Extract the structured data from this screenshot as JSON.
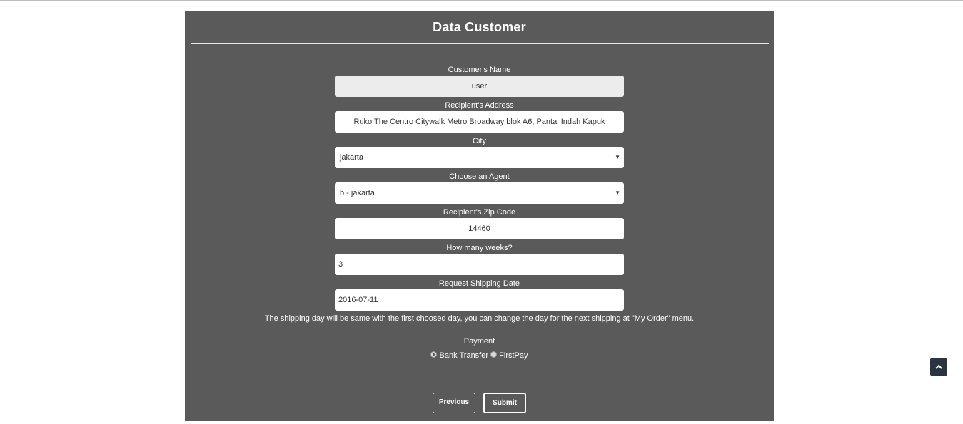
{
  "form": {
    "title": "Data Customer",
    "customer_name": {
      "label": "Customer's Name",
      "value": "user"
    },
    "address": {
      "label": "Recipient's Address",
      "value": "Ruko The Centro Citywalk Metro Broadway blok A6, Pantai Indah Kapuk"
    },
    "city": {
      "label": "City",
      "value": "jakarta"
    },
    "agent": {
      "label": "Choose an Agent",
      "value": "b - jakarta"
    },
    "zip": {
      "label": "Recipient's Zip Code",
      "value": "14460"
    },
    "weeks": {
      "label": "How many weeks?",
      "value": "3"
    },
    "shipping_date": {
      "label": "Request Shipping Date",
      "value": "2016-07-11"
    },
    "note": "The shipping day will be same with the first choosed day, you can change the day for the next shipping at \"My Order\" menu.",
    "payment": {
      "label": "Payment",
      "options": [
        {
          "label": "Bank Transfer",
          "checked": true
        },
        {
          "label": "FirstPay",
          "checked": false
        }
      ]
    },
    "buttons": {
      "previous": "Previous",
      "submit": "Submit"
    }
  },
  "icons": {
    "scroll_top": "chevron-up-icon",
    "select_caret": "caret-down-icon"
  }
}
